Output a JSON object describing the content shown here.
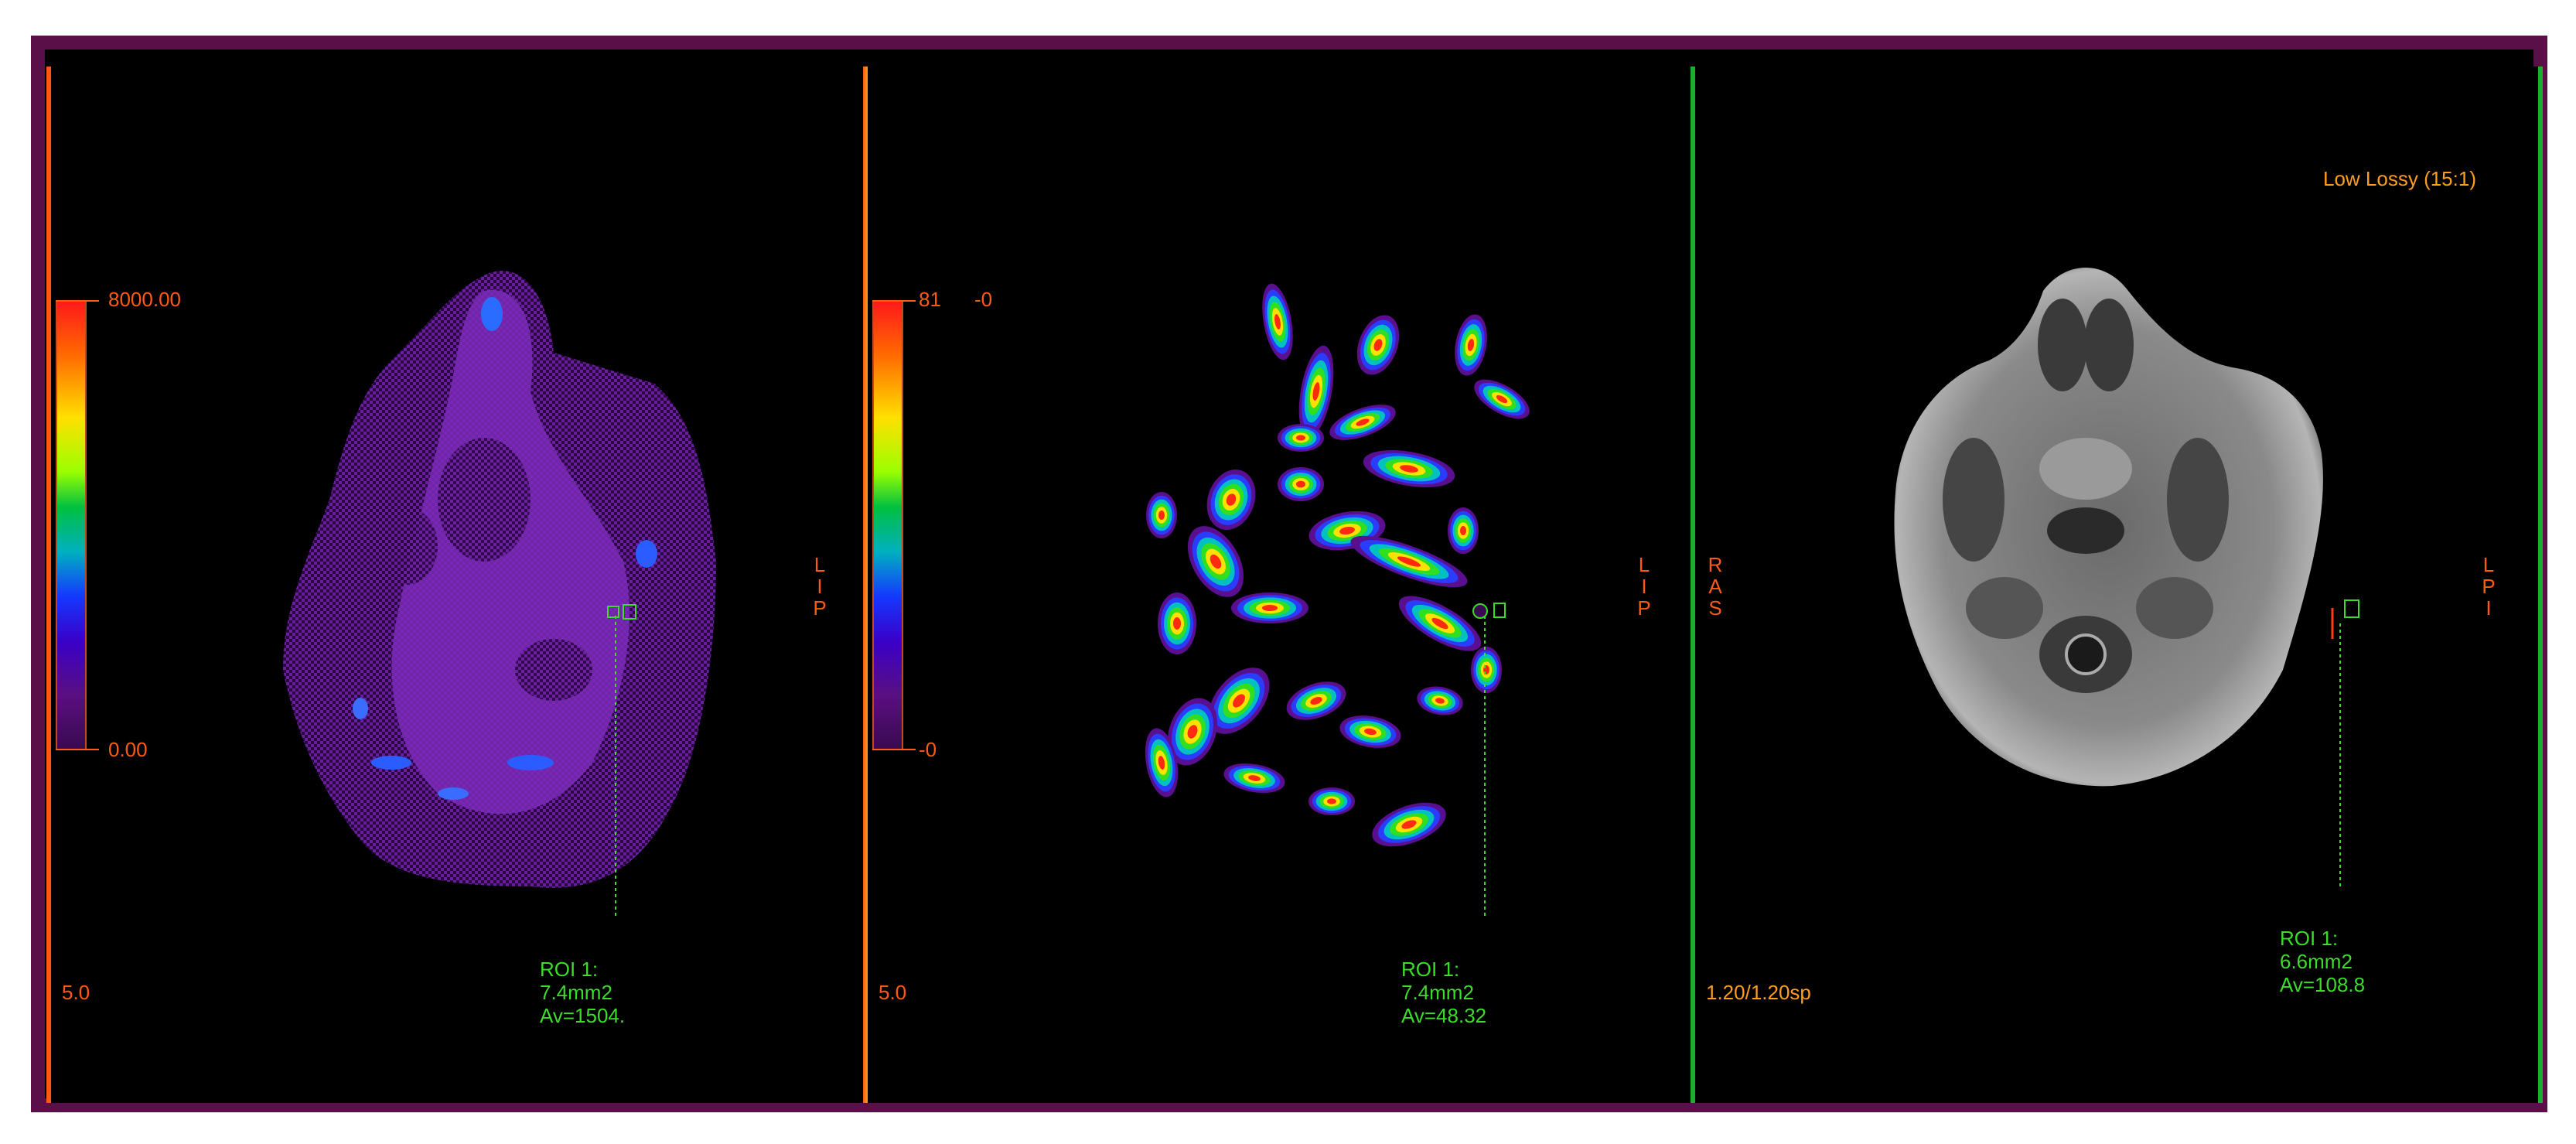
{
  "panels": [
    {
      "colorbar": {
        "max_label": "8000.00",
        "min_label": "0.00"
      },
      "orientation": [
        "L",
        "I",
        "P"
      ],
      "slice_thickness": "5.0",
      "roi": {
        "name": "ROI 1:",
        "area": "7.4mm2",
        "avg": "Av=1504."
      }
    },
    {
      "colorbar": {
        "max_label": "81",
        "max_label_extra": "-0",
        "min_label": "-0"
      },
      "orientation": [
        "L",
        "I",
        "P"
      ],
      "slice_thickness": "5.0",
      "roi": {
        "name": "ROI 1:",
        "area": "7.4mm2",
        "avg": "Av=48.32"
      }
    },
    {
      "compression": "Low Lossy (15:1)",
      "orientation_left": [
        "R",
        "A",
        "S"
      ],
      "orientation_right": [
        "L",
        "P",
        "I"
      ],
      "slice_spacing": "1.20/1.20sp",
      "roi": {
        "name": "ROI 1:",
        "area": "6.6mm2",
        "avg": "Av=108.8"
      }
    }
  ],
  "colors": {
    "frame": "#5a0f48",
    "overlay_text": "#ff5a14",
    "roi_text": "#3bdc2a",
    "divider_left": "#ff5a14",
    "divider_right": "#1fae2a"
  }
}
